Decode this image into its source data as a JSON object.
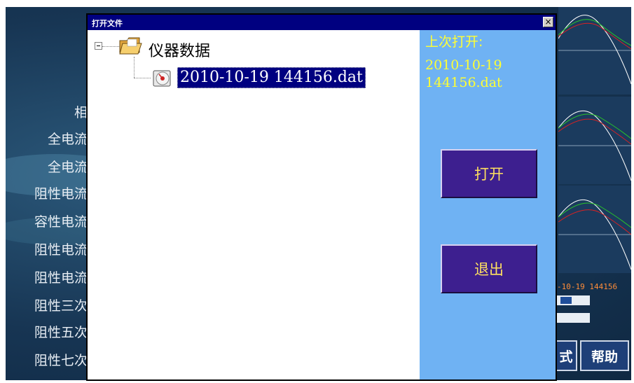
{
  "background": {
    "side_labels": [
      "相",
      "全电流",
      "全电流",
      "阻性电流",
      "容性电流",
      "阻性电流",
      "阻性电流",
      "阻性三次",
      "阻性五次",
      "阻性七次"
    ],
    "right_file_text": "-10-19 144156",
    "button_partial_left": "式",
    "button_help": "帮助"
  },
  "dialog": {
    "title": "打开文件",
    "close_symbol": "×",
    "tree": {
      "root": {
        "label": "仪器数据",
        "expanded": true,
        "icon": "folder-open-icon",
        "children": [
          {
            "label": "2010-10-19 144156.dat",
            "icon": "disk-file-icon",
            "selected": true
          }
        ]
      }
    },
    "info": {
      "last_open_label": "上次打开:",
      "last_open_file": "2010-10-19 144156.dat"
    },
    "buttons": {
      "open": "打开",
      "exit": "退出"
    }
  },
  "colors": {
    "titlebar": "#000080",
    "info_pane": "#6fb2f3",
    "button_bg": "#3d1f8f",
    "button_text": "#ffe060",
    "info_text": "#ffff33",
    "selection": "#000080"
  }
}
